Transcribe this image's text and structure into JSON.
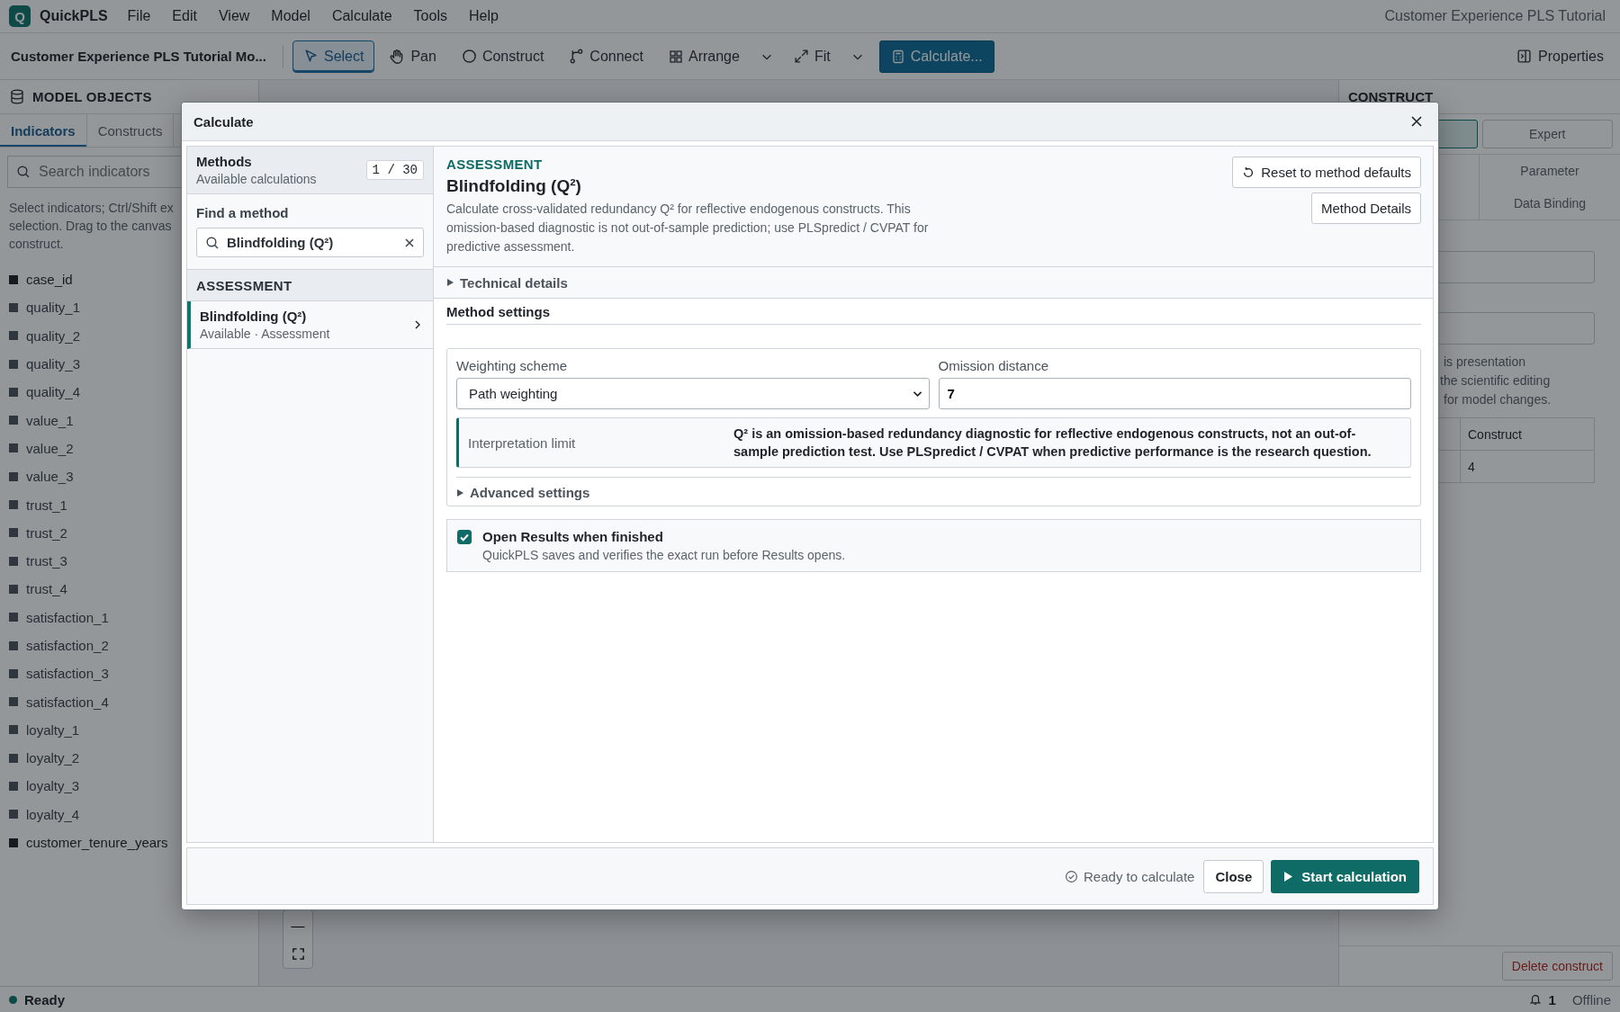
{
  "app": {
    "logo": "Q",
    "name": "QuickPLS",
    "menu": [
      "File",
      "Edit",
      "View",
      "Model",
      "Calculate",
      "Tools",
      "Help"
    ],
    "title": "Customer Experience PLS Tutorial"
  },
  "toolbar": {
    "project": "Customer Experience PLS Tutorial Mo...",
    "tools": [
      {
        "kind": "select",
        "label": "Select",
        "selected": true
      },
      {
        "kind": "pan",
        "label": "Pan",
        "selected": false
      },
      {
        "kind": "construct",
        "label": "Construct",
        "selected": false
      },
      {
        "kind": "connect",
        "label": "Connect",
        "selected": false
      },
      {
        "kind": "arrange",
        "label": "Arrange",
        "selected": false
      },
      {
        "kind": "caret",
        "selected": false
      },
      {
        "kind": "fit",
        "label": "Fit",
        "selected": false
      },
      {
        "kind": "caret",
        "selected": false
      }
    ],
    "calculate": "Calculate...",
    "properties": "Properties"
  },
  "sidebar": {
    "heading": "MODEL OBJECTS",
    "tabs": [
      {
        "label": "Indicators",
        "selected": true
      },
      {
        "label": "Constructs",
        "selected": false
      }
    ],
    "search_placeholder": "Search indicators",
    "help_lines": [
      "Select indicators; Ctrl/Shift ex",
      "selection. Drag to the canvas",
      "construct."
    ],
    "indicators": [
      {
        "name": "case_id",
        "assigned": false
      },
      {
        "name": "quality_1",
        "assigned": true
      },
      {
        "name": "quality_2",
        "assigned": true
      },
      {
        "name": "quality_3",
        "assigned": true
      },
      {
        "name": "quality_4",
        "assigned": true
      },
      {
        "name": "value_1",
        "assigned": true
      },
      {
        "name": "value_2",
        "assigned": true
      },
      {
        "name": "value_3",
        "assigned": true
      },
      {
        "name": "trust_1",
        "assigned": true
      },
      {
        "name": "trust_2",
        "assigned": true
      },
      {
        "name": "trust_3",
        "assigned": true
      },
      {
        "name": "trust_4",
        "assigned": true
      },
      {
        "name": "satisfaction_1",
        "assigned": true
      },
      {
        "name": "satisfaction_2",
        "assigned": true
      },
      {
        "name": "satisfaction_3",
        "assigned": true
      },
      {
        "name": "satisfaction_4",
        "assigned": true
      },
      {
        "name": "loyalty_1",
        "assigned": true
      },
      {
        "name": "loyalty_2",
        "assigned": true
      },
      {
        "name": "loyalty_3",
        "assigned": true
      },
      {
        "name": "loyalty_4",
        "assigned": true
      },
      {
        "name": "customer_tenure_years",
        "assigned": false
      }
    ]
  },
  "canvas": {
    "zoom_out": "—"
  },
  "right_panel": {
    "heading": "CONSTRUCT",
    "mode_buttons": [
      {
        "selected": true
      },
      {
        "label": "Expert",
        "selected": false
      }
    ],
    "tabs": [
      {
        "label": "Parameter",
        "selected": false
      },
      {
        "label": "Data Binding",
        "selected": false
      }
    ],
    "note_lines": [
      "is presentation",
      "the scientific editing",
      "for model changes."
    ],
    "table": {
      "column": "Construct",
      "value": "4"
    },
    "delete": "Delete construct"
  },
  "status_bar": {
    "status": "Ready",
    "notifications": "1",
    "connection": "Offline"
  },
  "dialog": {
    "title": "Calculate",
    "methods": {
      "title": "Methods",
      "subtitle": "Available calculations",
      "count": "1 / 30",
      "find_label": "Find a method",
      "search_value": "Blindfolding (Q²)",
      "groups": [
        {
          "name": "ASSESSMENT",
          "items": [
            {
              "name": "Blindfolding (Q²)",
              "meta": "Available · Assessment",
              "selected": true
            }
          ]
        }
      ]
    },
    "detail": {
      "category": "ASSESSMENT",
      "title": "Blindfolding (Q²)",
      "description": "Calculate cross-validated redundancy Q² for reflective endogenous constructs. This omission-based diagnostic is not out-of-sample prediction; use PLSpredict / CVPAT for predictive assessment.",
      "reset": "Reset to method defaults",
      "details": "Method Details",
      "technical": {
        "label": "Technical details",
        "expanded": false
      },
      "settings_heading": "Method settings",
      "fields": [
        {
          "kind": "select",
          "label": "Weighting scheme",
          "value": "Path weighting"
        },
        {
          "kind": "text",
          "label": "Omission distance",
          "value": "7"
        }
      ],
      "note": {
        "label": "Interpretation limit",
        "text": "Q² is an omission-based redundancy diagnostic for reflective endogenous constructs, not an out-of-sample prediction test. Use PLSpredict / CVPAT when predictive performance is the research question."
      },
      "advanced": {
        "label": "Advanced settings",
        "expanded": false
      },
      "open_results": {
        "label": "Open Results when finished",
        "description": "QuickPLS saves and verifies the exact run before Results opens.",
        "checked": true
      }
    },
    "footer": {
      "status": "Ready to calculate",
      "close": "Close",
      "start": "Start calculation"
    }
  }
}
